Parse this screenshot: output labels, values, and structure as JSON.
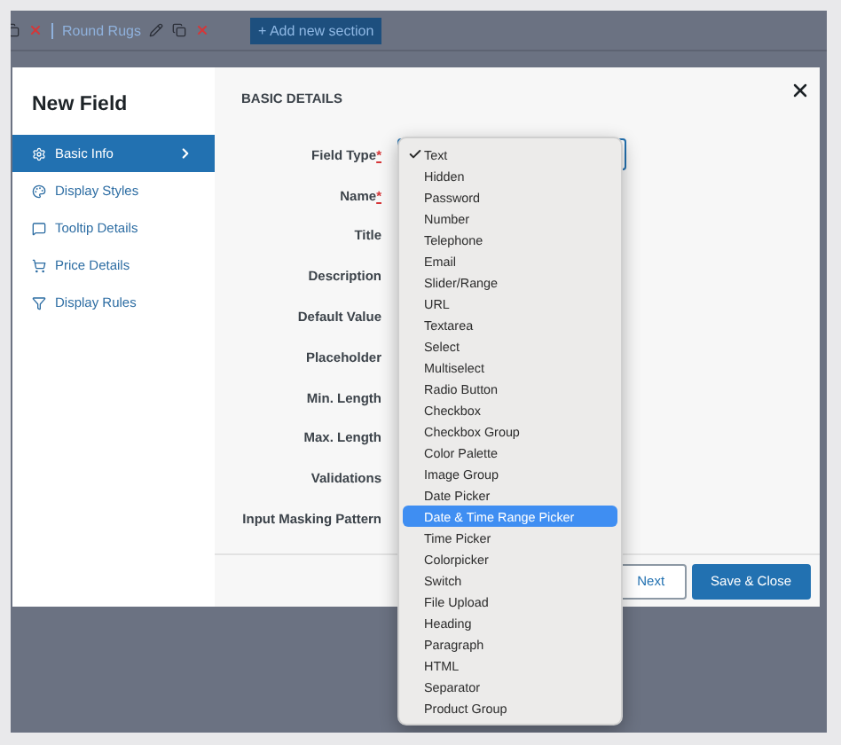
{
  "top_bar": {
    "section_name": "Round Rugs",
    "add_button": "+ Add new section"
  },
  "modal": {
    "title": "New Field",
    "nav": [
      {
        "label": "Basic Info",
        "selected": true
      },
      {
        "label": "Display Styles",
        "selected": false
      },
      {
        "label": "Tooltip Details",
        "selected": false
      },
      {
        "label": "Price Details",
        "selected": false
      },
      {
        "label": "Display Rules",
        "selected": false
      }
    ],
    "section_heading": "BASIC DETAILS",
    "fields": [
      {
        "label": "Field Type",
        "required_mark": "*"
      },
      {
        "label": "Name",
        "required_mark": "*"
      },
      {
        "label": "Title"
      },
      {
        "label": "Description"
      },
      {
        "label": "Default Value"
      },
      {
        "label": "Placeholder"
      },
      {
        "label": "Min. Length"
      },
      {
        "label": "Max. Length"
      },
      {
        "label": "Validations"
      },
      {
        "label": "Input Masking Pattern"
      }
    ],
    "dropdown_options": [
      {
        "label": "Text",
        "checked": true,
        "highlighted": false
      },
      {
        "label": "Hidden",
        "checked": false,
        "highlighted": false
      },
      {
        "label": "Password",
        "checked": false,
        "highlighted": false
      },
      {
        "label": "Number",
        "checked": false,
        "highlighted": false
      },
      {
        "label": "Telephone",
        "checked": false,
        "highlighted": false
      },
      {
        "label": "Email",
        "checked": false,
        "highlighted": false
      },
      {
        "label": "Slider/Range",
        "checked": false,
        "highlighted": false
      },
      {
        "label": "URL",
        "checked": false,
        "highlighted": false
      },
      {
        "label": "Textarea",
        "checked": false,
        "highlighted": false
      },
      {
        "label": "Select",
        "checked": false,
        "highlighted": false
      },
      {
        "label": "Multiselect",
        "checked": false,
        "highlighted": false
      },
      {
        "label": "Radio Button",
        "checked": false,
        "highlighted": false
      },
      {
        "label": "Checkbox",
        "checked": false,
        "highlighted": false
      },
      {
        "label": "Checkbox Group",
        "checked": false,
        "highlighted": false
      },
      {
        "label": "Color Palette",
        "checked": false,
        "highlighted": false
      },
      {
        "label": "Image Group",
        "checked": false,
        "highlighted": false
      },
      {
        "label": "Date Picker",
        "checked": false,
        "highlighted": false
      },
      {
        "label": "Date & Time Range Picker",
        "checked": false,
        "highlighted": true
      },
      {
        "label": "Time Picker",
        "checked": false,
        "highlighted": false
      },
      {
        "label": "Colorpicker",
        "checked": false,
        "highlighted": false
      },
      {
        "label": "Switch",
        "checked": false,
        "highlighted": false
      },
      {
        "label": "File Upload",
        "checked": false,
        "highlighted": false
      },
      {
        "label": "Heading",
        "checked": false,
        "highlighted": false
      },
      {
        "label": "Paragraph",
        "checked": false,
        "highlighted": false
      },
      {
        "label": "HTML",
        "checked": false,
        "highlighted": false
      },
      {
        "label": "Separator",
        "checked": false,
        "highlighted": false
      },
      {
        "label": "Product Group",
        "checked": false,
        "highlighted": false
      }
    ],
    "buttons": [
      {
        "label": "Next",
        "kind": "secondary"
      },
      {
        "label": "Save & Close",
        "kind": "primary"
      }
    ]
  }
}
